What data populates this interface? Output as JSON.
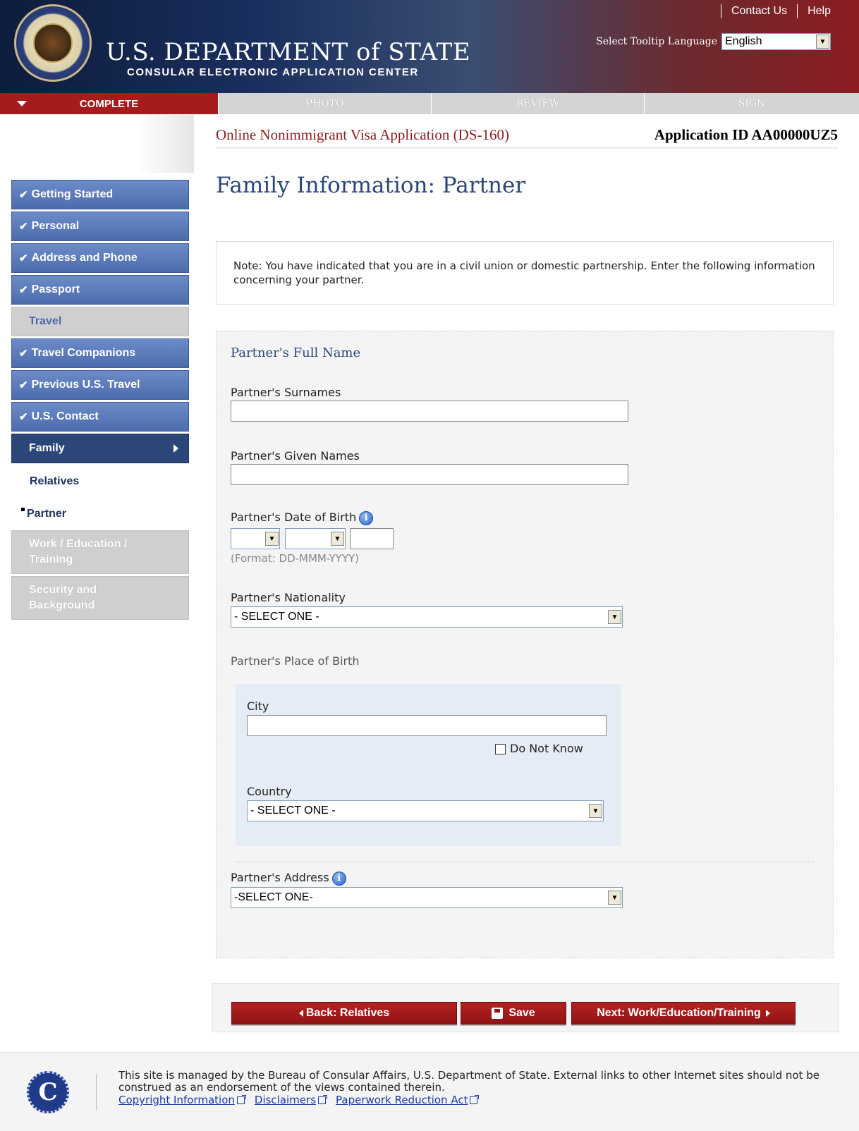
{
  "header": {
    "title": "U.S. DEPARTMENT of STATE",
    "subtitle": "CONSULAR ELECTRONIC APPLICATION CENTER",
    "links": [
      "Contact Us",
      "Help"
    ],
    "tooltip_label": "Select Tooltip Language",
    "tooltip_value": "English"
  },
  "progress": {
    "steps": [
      "COMPLETE",
      "PHOTO",
      "REVIEW",
      "SIGN"
    ],
    "active_index": 0
  },
  "sidebar": {
    "items": [
      {
        "label": "Getting Started",
        "state": "done"
      },
      {
        "label": "Personal",
        "state": "done"
      },
      {
        "label": "Address and Phone",
        "state": "done"
      },
      {
        "label": "Passport",
        "state": "done"
      },
      {
        "label": "Travel",
        "state": "plain"
      },
      {
        "label": "Travel Companions",
        "state": "done"
      },
      {
        "label": "Previous U.S. Travel",
        "state": "done"
      },
      {
        "label": "U.S. Contact",
        "state": "done"
      },
      {
        "label": "Family",
        "state": "current"
      }
    ],
    "subitems": [
      "Relatives",
      "Partner"
    ],
    "disabled": [
      "Work / Education / Training",
      "Security and Background"
    ]
  },
  "app": {
    "title": "Online Nonimmigrant Visa Application (DS-160)",
    "id": "Application ID AA00000UZ5"
  },
  "page_title": "Family Information: Partner",
  "note": "Note: You have indicated that you are in a civil union or domestic partnership. Enter the following information concerning your partner.",
  "form": {
    "full_name_heading": "Partner's Full Name",
    "surnames_label": "Partner's Surnames",
    "given_names_label": "Partner's Given Names",
    "dob_label": "Partner's Date of Birth",
    "dob_format": "(Format: DD-MMM-YYYY)",
    "nationality_label": "Partner's Nationality",
    "nationality_value": "- SELECT ONE -",
    "pob_label": "Partner's Place of Birth",
    "city_label": "City",
    "do_not_know": "Do Not Know",
    "country_label": "Country",
    "country_value": "- SELECT ONE -",
    "address_label": "Partner's Address",
    "address_value": "-SELECT ONE-"
  },
  "buttons": {
    "back": "Back: Relatives",
    "save": "Save",
    "next": "Next: Work/Education/Training"
  },
  "footer": {
    "text": "This site is managed by the Bureau of Consular Affairs, U.S. Department of State. External links to other Internet sites should not be construed as an endorsement of the views contained therein.",
    "links": [
      "Copyright Information",
      "Disclaimers",
      "Paperwork Reduction Act"
    ],
    "logo_letter": "C"
  }
}
